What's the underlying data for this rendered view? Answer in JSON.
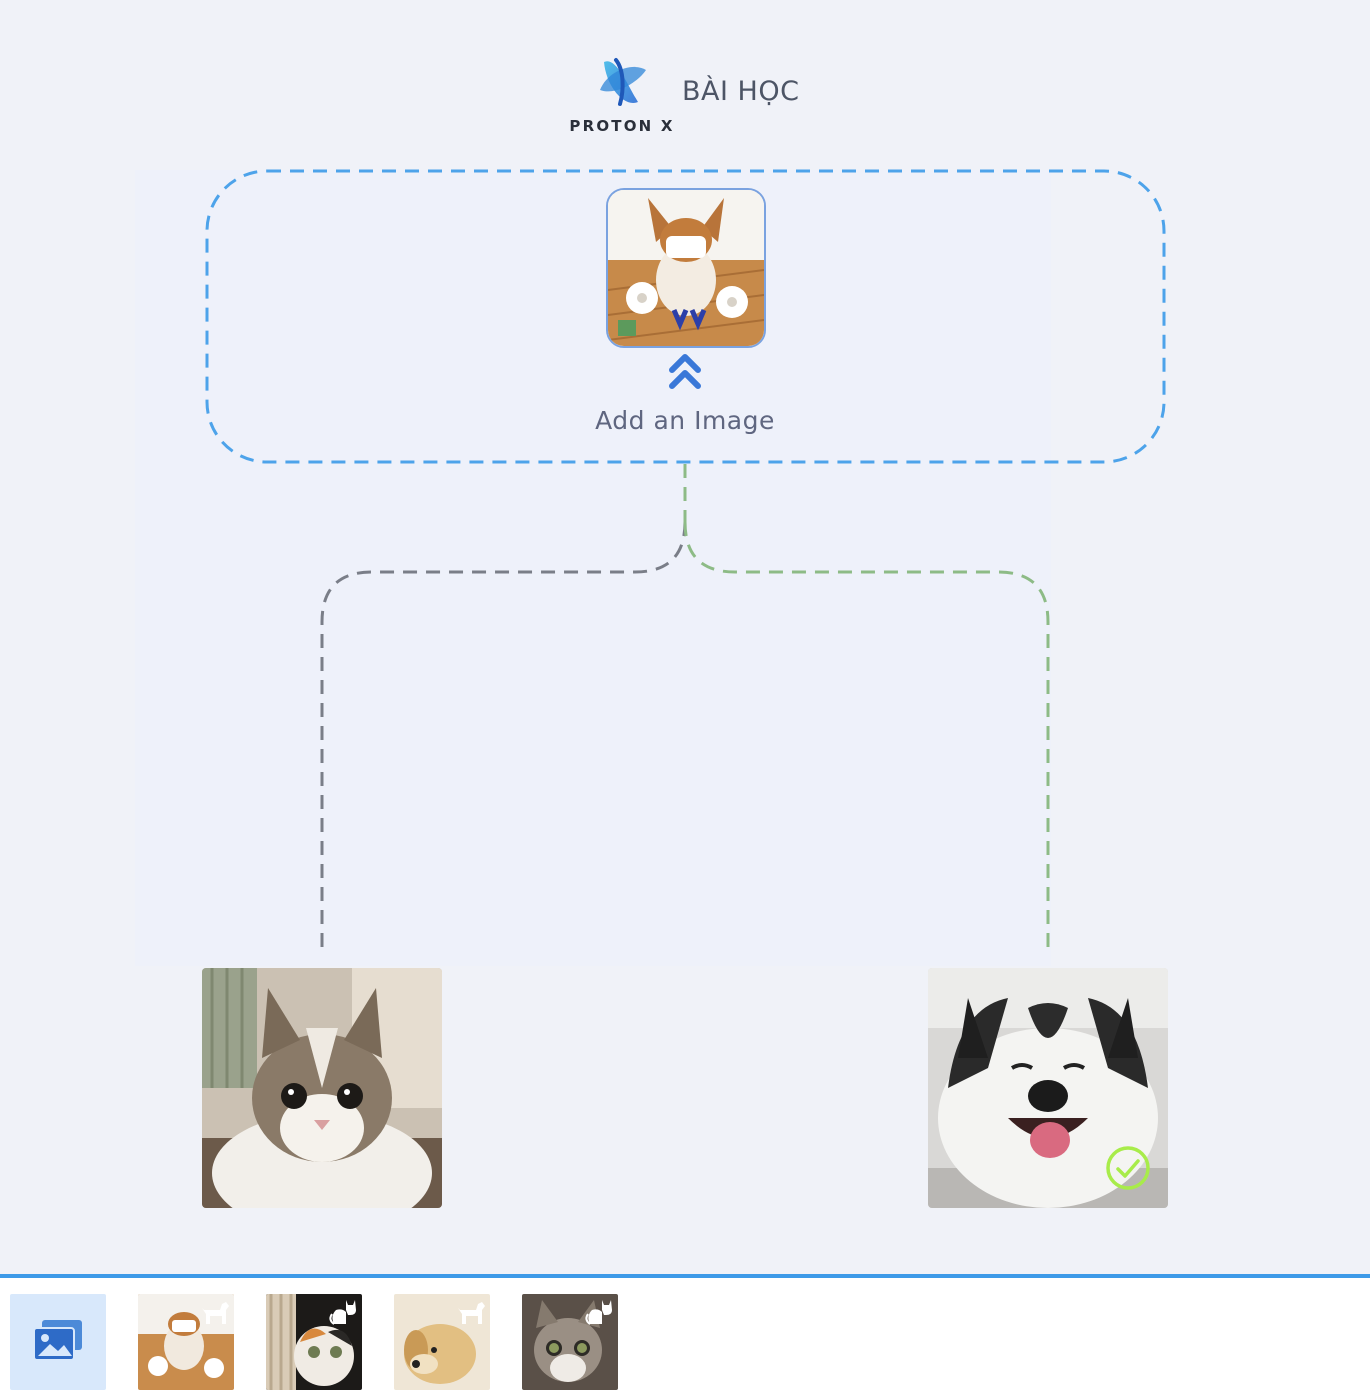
{
  "header": {
    "brand_name": "PROTON X",
    "page_title": "BÀI HỌC"
  },
  "tree": {
    "root": {
      "label": "Add an Image",
      "image": "dog-with-mask-and-toilet-paper-photo",
      "icon": "double-chevron-up-icon"
    },
    "branches": [
      {
        "image": "tabby-cat-photo",
        "connector_color": "#7a7e88",
        "selected": false
      },
      {
        "image": "husky-dog-photo",
        "connector_color": "#8dbb86",
        "selected": true,
        "selected_icon": "check-circle-icon"
      }
    ],
    "drop_zone_color": "#4da3ea"
  },
  "tray": {
    "gallery_icon": "image-gallery-icon",
    "thumbnails": [
      {
        "image": "dog-with-mask-photo",
        "badge_icon": "dog-icon"
      },
      {
        "image": "calico-kitten-photo",
        "badge_icon": "cat-icon"
      },
      {
        "image": "golden-puppy-photo",
        "badge_icon": "dog-icon"
      },
      {
        "image": "tabby-kitten-photo",
        "badge_icon": "cat-icon"
      }
    ],
    "accent_color": "#3d9ae8"
  }
}
